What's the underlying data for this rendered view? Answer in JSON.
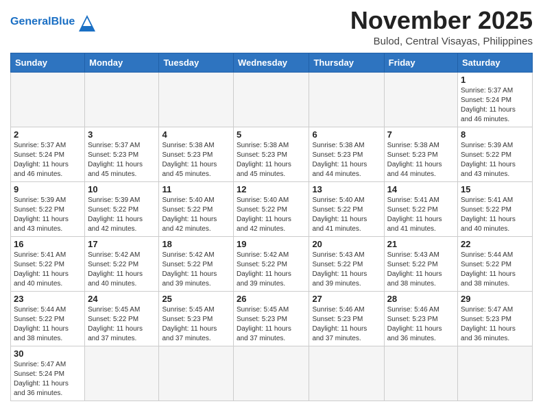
{
  "header": {
    "logo_general": "General",
    "logo_blue": "Blue",
    "month_title": "November 2025",
    "location": "Bulod, Central Visayas, Philippines"
  },
  "weekdays": [
    "Sunday",
    "Monday",
    "Tuesday",
    "Wednesday",
    "Thursday",
    "Friday",
    "Saturday"
  ],
  "weeks": [
    [
      {
        "day": "",
        "info": ""
      },
      {
        "day": "",
        "info": ""
      },
      {
        "day": "",
        "info": ""
      },
      {
        "day": "",
        "info": ""
      },
      {
        "day": "",
        "info": ""
      },
      {
        "day": "",
        "info": ""
      },
      {
        "day": "1",
        "info": "Sunrise: 5:37 AM\nSunset: 5:24 PM\nDaylight: 11 hours\nand 46 minutes."
      }
    ],
    [
      {
        "day": "2",
        "info": "Sunrise: 5:37 AM\nSunset: 5:24 PM\nDaylight: 11 hours\nand 46 minutes."
      },
      {
        "day": "3",
        "info": "Sunrise: 5:37 AM\nSunset: 5:23 PM\nDaylight: 11 hours\nand 45 minutes."
      },
      {
        "day": "4",
        "info": "Sunrise: 5:38 AM\nSunset: 5:23 PM\nDaylight: 11 hours\nand 45 minutes."
      },
      {
        "day": "5",
        "info": "Sunrise: 5:38 AM\nSunset: 5:23 PM\nDaylight: 11 hours\nand 45 minutes."
      },
      {
        "day": "6",
        "info": "Sunrise: 5:38 AM\nSunset: 5:23 PM\nDaylight: 11 hours\nand 44 minutes."
      },
      {
        "day": "7",
        "info": "Sunrise: 5:38 AM\nSunset: 5:23 PM\nDaylight: 11 hours\nand 44 minutes."
      },
      {
        "day": "8",
        "info": "Sunrise: 5:39 AM\nSunset: 5:22 PM\nDaylight: 11 hours\nand 43 minutes."
      }
    ],
    [
      {
        "day": "9",
        "info": "Sunrise: 5:39 AM\nSunset: 5:22 PM\nDaylight: 11 hours\nand 43 minutes."
      },
      {
        "day": "10",
        "info": "Sunrise: 5:39 AM\nSunset: 5:22 PM\nDaylight: 11 hours\nand 42 minutes."
      },
      {
        "day": "11",
        "info": "Sunrise: 5:40 AM\nSunset: 5:22 PM\nDaylight: 11 hours\nand 42 minutes."
      },
      {
        "day": "12",
        "info": "Sunrise: 5:40 AM\nSunset: 5:22 PM\nDaylight: 11 hours\nand 42 minutes."
      },
      {
        "day": "13",
        "info": "Sunrise: 5:40 AM\nSunset: 5:22 PM\nDaylight: 11 hours\nand 41 minutes."
      },
      {
        "day": "14",
        "info": "Sunrise: 5:41 AM\nSunset: 5:22 PM\nDaylight: 11 hours\nand 41 minutes."
      },
      {
        "day": "15",
        "info": "Sunrise: 5:41 AM\nSunset: 5:22 PM\nDaylight: 11 hours\nand 40 minutes."
      }
    ],
    [
      {
        "day": "16",
        "info": "Sunrise: 5:41 AM\nSunset: 5:22 PM\nDaylight: 11 hours\nand 40 minutes."
      },
      {
        "day": "17",
        "info": "Sunrise: 5:42 AM\nSunset: 5:22 PM\nDaylight: 11 hours\nand 40 minutes."
      },
      {
        "day": "18",
        "info": "Sunrise: 5:42 AM\nSunset: 5:22 PM\nDaylight: 11 hours\nand 39 minutes."
      },
      {
        "day": "19",
        "info": "Sunrise: 5:42 AM\nSunset: 5:22 PM\nDaylight: 11 hours\nand 39 minutes."
      },
      {
        "day": "20",
        "info": "Sunrise: 5:43 AM\nSunset: 5:22 PM\nDaylight: 11 hours\nand 39 minutes."
      },
      {
        "day": "21",
        "info": "Sunrise: 5:43 AM\nSunset: 5:22 PM\nDaylight: 11 hours\nand 38 minutes."
      },
      {
        "day": "22",
        "info": "Sunrise: 5:44 AM\nSunset: 5:22 PM\nDaylight: 11 hours\nand 38 minutes."
      }
    ],
    [
      {
        "day": "23",
        "info": "Sunrise: 5:44 AM\nSunset: 5:22 PM\nDaylight: 11 hours\nand 38 minutes."
      },
      {
        "day": "24",
        "info": "Sunrise: 5:45 AM\nSunset: 5:22 PM\nDaylight: 11 hours\nand 37 minutes."
      },
      {
        "day": "25",
        "info": "Sunrise: 5:45 AM\nSunset: 5:23 PM\nDaylight: 11 hours\nand 37 minutes."
      },
      {
        "day": "26",
        "info": "Sunrise: 5:45 AM\nSunset: 5:23 PM\nDaylight: 11 hours\nand 37 minutes."
      },
      {
        "day": "27",
        "info": "Sunrise: 5:46 AM\nSunset: 5:23 PM\nDaylight: 11 hours\nand 37 minutes."
      },
      {
        "day": "28",
        "info": "Sunrise: 5:46 AM\nSunset: 5:23 PM\nDaylight: 11 hours\nand 36 minutes."
      },
      {
        "day": "29",
        "info": "Sunrise: 5:47 AM\nSunset: 5:23 PM\nDaylight: 11 hours\nand 36 minutes."
      }
    ],
    [
      {
        "day": "30",
        "info": "Sunrise: 5:47 AM\nSunset: 5:24 PM\nDaylight: 11 hours\nand 36 minutes."
      },
      {
        "day": "",
        "info": ""
      },
      {
        "day": "",
        "info": ""
      },
      {
        "day": "",
        "info": ""
      },
      {
        "day": "",
        "info": ""
      },
      {
        "day": "",
        "info": ""
      },
      {
        "day": "",
        "info": ""
      }
    ]
  ]
}
